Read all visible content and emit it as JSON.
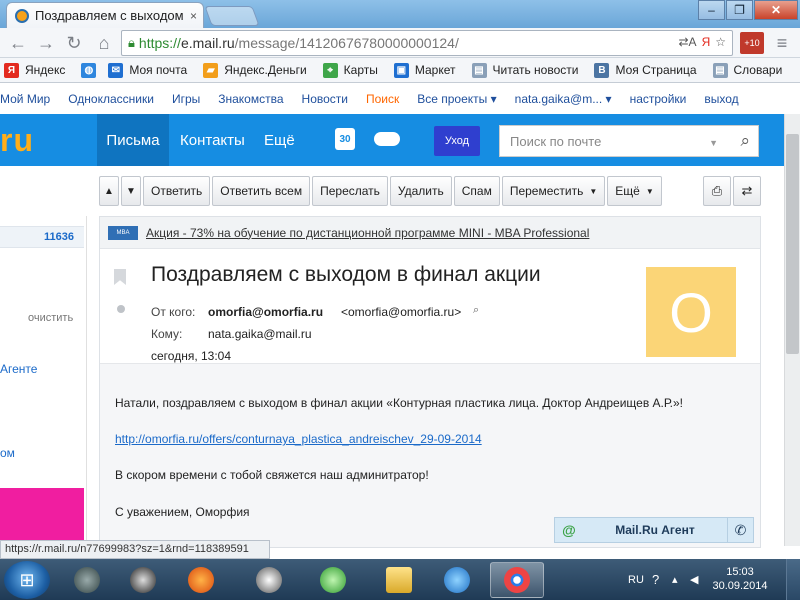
{
  "browser": {
    "tab_title": "Поздравляем с выходом",
    "tab_close": "×",
    "win_minimize": "–",
    "win_restore": "❐",
    "win_close": "✕",
    "url_scheme": "https://",
    "url_host": "e.mail.ru",
    "url_path": "/message/14120676780000000124/",
    "status_url": "https://r.mail.ru/n77699983?sz=1&rnd=118389591"
  },
  "bookmarks": [
    {
      "label": "Яндекс",
      "icon": "yandex-icon",
      "color": "#e32a1f",
      "glyph": "Я"
    },
    {
      "label": "",
      "icon": "globe-icon",
      "color": "#2e86de",
      "glyph": "◍"
    },
    {
      "label": "Моя почта",
      "icon": "mail-icon",
      "color": "#1f6fd1",
      "glyph": "✉"
    },
    {
      "label": "Яндекс.Деньги",
      "icon": "wallet-icon",
      "color": "#f29e1b",
      "glyph": "▰"
    },
    {
      "label": "Карты",
      "icon": "map-icon",
      "color": "#3fa64a",
      "glyph": "⌖"
    },
    {
      "label": "Маркет",
      "icon": "cart-icon",
      "color": "#1f6fd1",
      "glyph": "▣"
    },
    {
      "label": "Читать новости",
      "icon": "page-icon",
      "color": "#8aa0b8",
      "glyph": "▤"
    },
    {
      "label": "Моя Страница",
      "icon": "vk-icon",
      "color": "#4c75a3",
      "glyph": "В"
    },
    {
      "label": "Словари",
      "icon": "book-icon",
      "color": "#8aa0b8",
      "glyph": "▤"
    }
  ],
  "portal": {
    "items": [
      "Мой Мир",
      "Одноклассники",
      "Игры",
      "Знакомства",
      "Новости",
      "Поиск",
      "Все проекты ▾"
    ],
    "user": "nata.gaika@m... ▾",
    "settings": "настройки",
    "logout": "выход"
  },
  "header": {
    "logo_prefix": "",
    "logo_text": "ru",
    "tabs": [
      "Письма",
      "Контакты",
      "Ещё"
    ],
    "calendar_day": "30",
    "ukhod": "Уход",
    "search_placeholder": "Поиск по почте"
  },
  "actions": {
    "prev": "▲",
    "next": "▼",
    "reply": "Ответить",
    "reply_all": "Ответить всем",
    "forward": "Переслать",
    "delete": "Удалить",
    "spam": "Спам",
    "move": "Переместить",
    "more": "Ещё",
    "print": "⎙",
    "swap": "⇄"
  },
  "sidebar": {
    "count": "11636",
    "clear": "очистить",
    "agent": "Агенте",
    "om": "ом"
  },
  "message": {
    "ad_text": "Акция - 73% на обучение по дистанционной программе MINI - MBA Professional",
    "subject": "Поздравляем с выходом в финал акции",
    "from_label": "От кого:",
    "from_name": "omorfia@omorfia.ru",
    "from_email": "<omorfia@omorfia.ru>",
    "to_label": "Кому:",
    "to": "nata.gaika@mail.ru",
    "date": "сегодня, 13:04",
    "avatar_letter": "O",
    "body": {
      "greeting": "Натали, поздравляем с выходом в финал акции «Контурная пластика лица. Доктор Андреищев А.Р.»!",
      "link": "http://omorfia.ru/offers/conturnaya_plastica_andreischev_29-09-2014",
      "p2": "В скором времени с тобой свяжется наш админитратор!",
      "sign": "С уважением, Оморфия"
    }
  },
  "agent": {
    "at": "@",
    "name": "Mail.Ru Агент",
    "phone": "✆"
  },
  "taskbar": {
    "lang": "RU",
    "time": "15:03",
    "date": "30.09.2014"
  },
  "colors": {
    "accent": "#168de2",
    "portal_link": "#1f4f9c",
    "portal_highlight": "#ff6600",
    "avatar_bg": "#fbd577",
    "ukhod_bg": "#2f3fcf"
  }
}
